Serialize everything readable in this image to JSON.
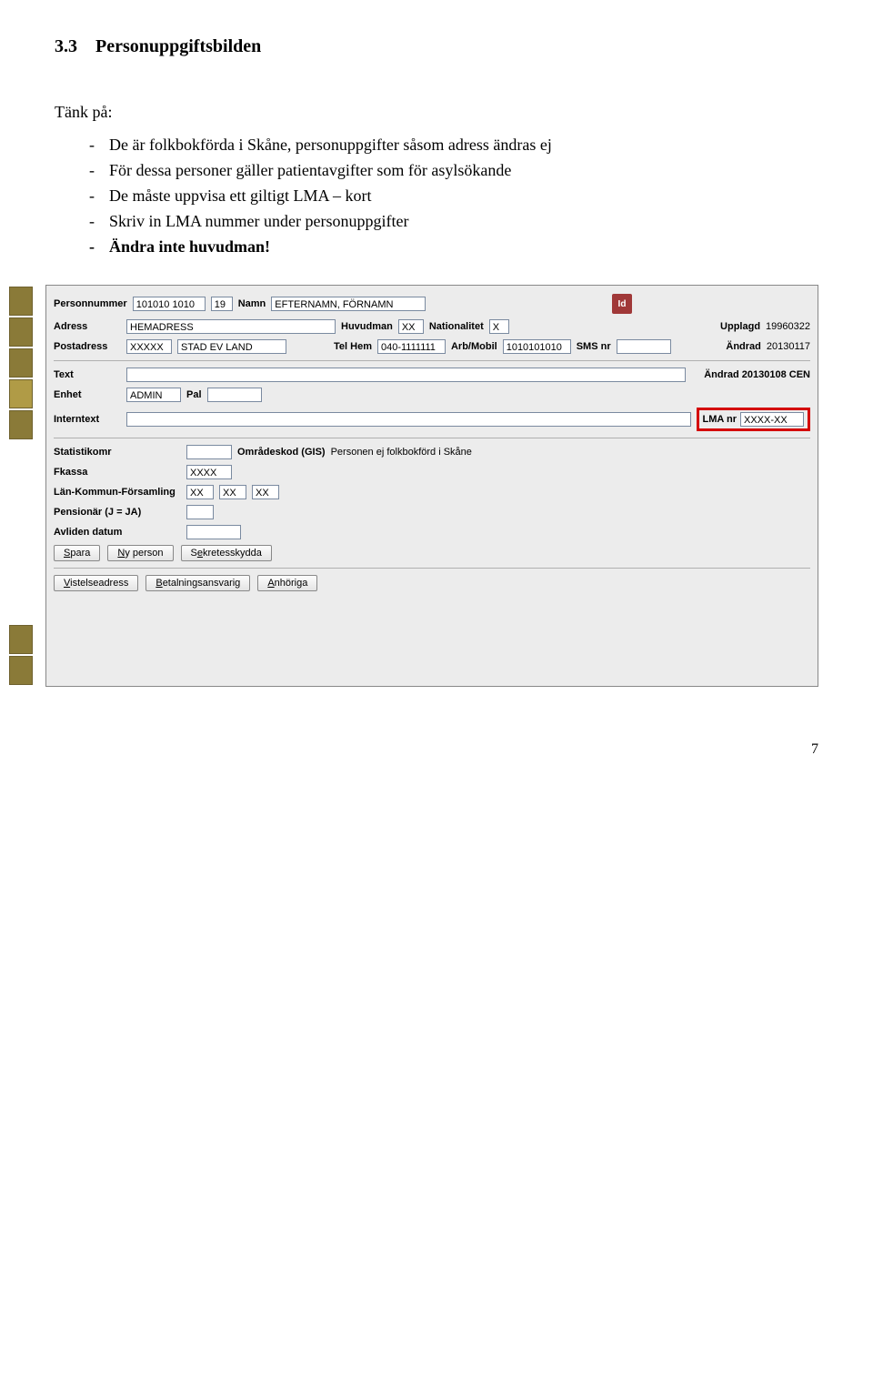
{
  "doc": {
    "section_num": "3.3",
    "section_title": "Personuppgiftsbilden",
    "think": "Tänk på:",
    "bullets": [
      "De är folkbokförda i Skåne, personuppgifter såsom adress ändras ej",
      "För dessa personer gäller patientavgifter som för asylsökande",
      "De måste uppvisa ett giltigt LMA – kort",
      "Skriv in LMA nummer under personuppgifter",
      "Ändra inte huvudman!"
    ],
    "page_number": "7"
  },
  "form": {
    "labels": {
      "personnummer": "Personnummer",
      "namn": "Namn",
      "adress": "Adress",
      "huvudman": "Huvudman",
      "nationalitet": "Nationalitet",
      "upplagd": "Upplagd",
      "postadress": "Postadress",
      "telhem": "Tel Hem",
      "arbmobil": "Arb/Mobil",
      "smsnr": "SMS nr",
      "andrad": "Ändrad",
      "text": "Text",
      "enhet": "Enhet",
      "pal": "Pal",
      "interntext": "Interntext",
      "lmanr": "LMA nr",
      "statistikomr": "Statistikomr",
      "omradeskod": "Områdeskod (GIS)",
      "fkassa": "Fkassa",
      "lkf": "Län-Kommun-Församling",
      "pensionar": "Pensionär (J = JA)",
      "avliden": "Avliden datum"
    },
    "values": {
      "personnummer": "101010 1010",
      "sekel": "19",
      "namn": "EFTERNAMN, FÖRNAMN",
      "adress": "HEMADRESS",
      "huvudman": "XX",
      "nationalitet": "X",
      "upplagd": "19960322",
      "postadress_nr": "XXXXX",
      "postadress_ort": "STAD EV LAND",
      "telhem": "040-1111111",
      "arbmobil": "1010101010",
      "smsnr": "",
      "andrad": "20130117",
      "text": "",
      "text_andrad": "Ändrad 20130108 CEN",
      "enhet": "ADMIN",
      "pal": "",
      "interntext": "",
      "lmanr": "XXXX-XX",
      "statistikomr": "",
      "omradeskod_note": "Personen ej folkbokförd i Skåne",
      "fkassa": "XXXX",
      "lkf1": "XX",
      "lkf2": "XX",
      "lkf3": "XX",
      "pensionar": "",
      "avliden": ""
    },
    "buttons": {
      "spara": "Spara",
      "nyperson": "Ny person",
      "sekretess": "Sekretesskydda",
      "vistelse": "Vistelseadress",
      "betalning": "Betalningsansvarig",
      "anhoriga": "Anhöriga"
    },
    "badge": "Id"
  }
}
